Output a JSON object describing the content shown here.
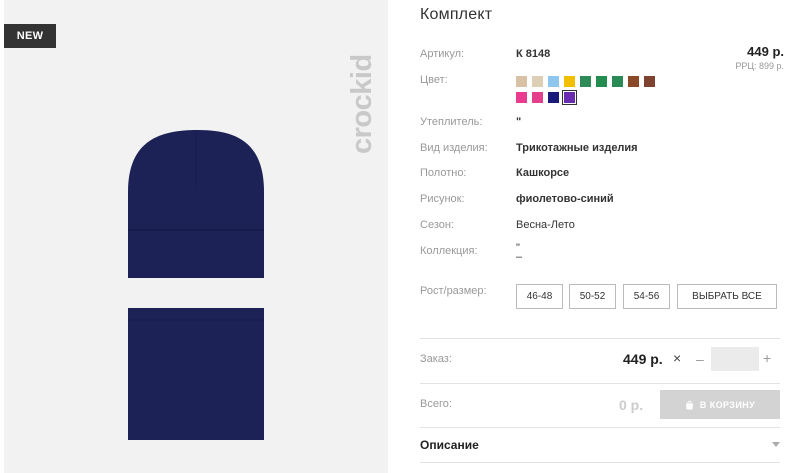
{
  "gallery": {
    "badge": "NEW",
    "brand": "crockid",
    "image_alt": "шапка и снуд"
  },
  "product": {
    "title": "Комплект",
    "price": "449 р.",
    "rrp": "РРЦ: 899 р."
  },
  "attributes": {
    "article": {
      "label": "Артикул:",
      "value": "К 8148"
    },
    "color": {
      "label": "Цвет:"
    },
    "insulation": {
      "label": "Утеплитель:",
      "value": "\""
    },
    "item_type": {
      "label": "Вид изделия:",
      "value": "Трикотажные изделия"
    },
    "fabric": {
      "label": "Полотно:",
      "value": "Кашкорсе"
    },
    "pattern": {
      "label": "Рисунок:",
      "value": "фиолетово-синий"
    },
    "season": {
      "label": "Сезон:",
      "value": "Весна-Лето"
    },
    "collection": {
      "label": "Коллекция:",
      "value_line1": "\"",
      "value_line2": "–"
    }
  },
  "swatches": [
    {
      "color": "#d8c0a4",
      "selected": false
    },
    {
      "color": "#dccfb6",
      "selected": false
    },
    {
      "color": "#8ec6ee",
      "selected": false
    },
    {
      "color": "#f2bf00",
      "selected": false
    },
    {
      "color": "#2e8b57",
      "selected": false
    },
    {
      "color": "#238c4f",
      "selected": false
    },
    {
      "color": "#2a8a56",
      "selected": false
    },
    {
      "color": "#8a4a2a",
      "selected": false
    },
    {
      "color": "#7e4330",
      "selected": false
    },
    {
      "color": "#ea3c8e",
      "selected": false
    },
    {
      "color": "#e33f8a",
      "selected": false
    },
    {
      "color": "#1a1a7a",
      "selected": false
    },
    {
      "color": "#6a2bb0",
      "selected": true
    }
  ],
  "sizes": {
    "label": "Рост/размер:",
    "options": [
      "46-48",
      "50-52",
      "54-56"
    ],
    "select_all": "ВЫБРАТЬ ВСЕ"
  },
  "order": {
    "label": "Заказ:",
    "price": "449 р.",
    "times": "×",
    "minus": "–",
    "plus": "+",
    "quantity": ""
  },
  "total": {
    "label": "Всего:",
    "value": "0 р.",
    "cart_button": "В КОРЗИНУ"
  },
  "description": {
    "title": "Описание"
  },
  "colors": {
    "hat": "#1c2156",
    "hat_shade": "#151a48",
    "badge_bg": "#333333",
    "cart_bg": "#d3d3d3"
  }
}
